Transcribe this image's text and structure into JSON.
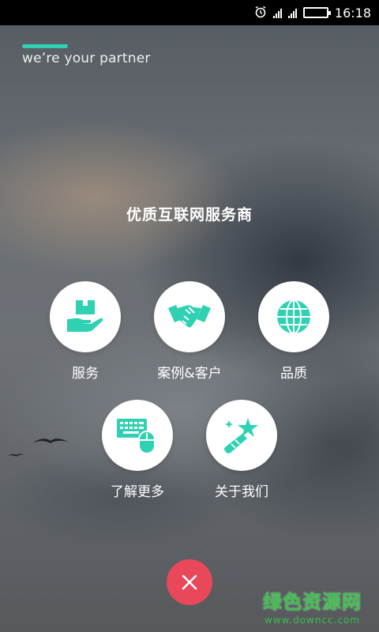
{
  "status_bar": {
    "time": "16:18",
    "icons": [
      "alarm-icon",
      "signal-icon",
      "signal-icon",
      "battery-icon"
    ],
    "battery_level": 1.0
  },
  "header": {
    "tagline": "we’re your partner",
    "accent_color": "#2fd1b2"
  },
  "main": {
    "heading": "优质互联网服务商",
    "items": [
      {
        "label": "服务",
        "icon": "box-in-hand-icon"
      },
      {
        "label": "案例&客户",
        "icon": "handshake-icon"
      },
      {
        "label": "品质",
        "icon": "globe-icon"
      },
      {
        "label": "了解更多",
        "icon": "keyboard-mouse-icon"
      },
      {
        "label": "关于我们",
        "icon": "magic-wand-icon"
      }
    ],
    "icon_color": "#2fd1b2"
  },
  "close_button": {
    "icon": "close-icon",
    "color": "#e8485a"
  },
  "watermark": {
    "title": "绿色资源网",
    "url": "www.downcc.com",
    "color": "#39c34a"
  }
}
